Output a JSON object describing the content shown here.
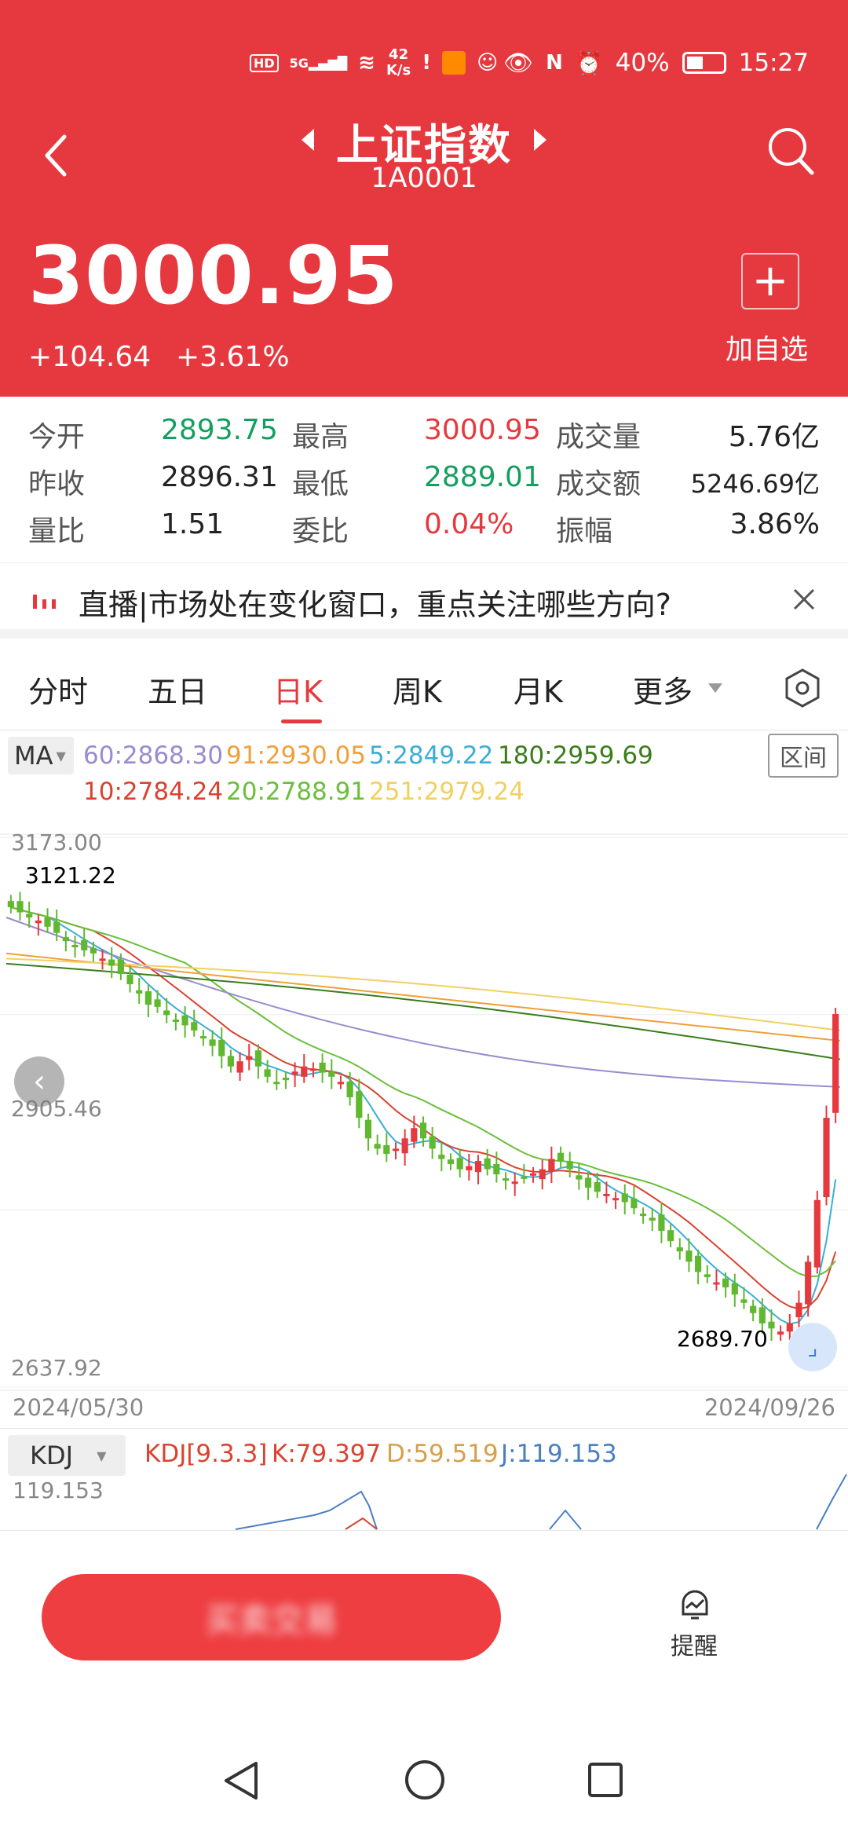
{
  "status_bar": {
    "left_icons": [
      "HD",
      "5G",
      "6",
      "42\nK/s"
    ],
    "netspeed_top": "42",
    "netspeed_bottom": "K/s",
    "battery": "40%",
    "time": "15:27"
  },
  "header": {
    "title": "上证指数",
    "code": "1A0001",
    "price": "3000.95",
    "change": "+104.64",
    "change_pct": "+3.61%",
    "add_label": "加自选",
    "color": "#e6393f"
  },
  "quotes": [
    {
      "label": "今开",
      "value": "2893.75",
      "color": "green"
    },
    {
      "label": "最高",
      "value": "3000.95",
      "color": "red"
    },
    {
      "label": "成交量",
      "value": "5.76亿",
      "color": "black"
    },
    {
      "label": "昨收",
      "value": "2896.31",
      "color": "black"
    },
    {
      "label": "最低",
      "value": "2889.01",
      "color": "green"
    },
    {
      "label": "成交额",
      "value": "5246.69亿",
      "color": "black"
    },
    {
      "label": "量比",
      "value": "1.51",
      "color": "black"
    },
    {
      "label": "委比",
      "value": "0.04%",
      "color": "red"
    },
    {
      "label": "振幅",
      "value": "3.86%",
      "color": "black"
    }
  ],
  "banner": {
    "text": "直播|市场处在变化窗口，重点关注哪些方向?"
  },
  "tabs": [
    "分时",
    "五日",
    "日K",
    "周K",
    "月K",
    "更多"
  ],
  "active_tab": "日K",
  "ma": {
    "selector": "MA",
    "range_button": "区间",
    "values": [
      {
        "label": "60:2868.30",
        "color": "#9a8bd0"
      },
      {
        "label": "91:2930.05",
        "color": "#f0a03a"
      },
      {
        "label": "5:2849.22",
        "color": "#3aaed8"
      },
      {
        "label": "180:2959.69",
        "color": "#3a7d1a"
      },
      {
        "label": "10:2784.24",
        "color": "#d9432f"
      },
      {
        "label": "20:2788.91",
        "color": "#6abf3a"
      },
      {
        "label": "251:2979.24",
        "color": "#f2d060"
      }
    ]
  },
  "chart_data": {
    "type": "candlestick",
    "y_labels": [
      "3173.00",
      "2905.46",
      "2637.92"
    ],
    "ylim": [
      2637.92,
      3173.0
    ],
    "high_label": "3121.22",
    "low_label": "2689.70",
    "x_start": "2024/05/30",
    "x_end": "2024/09/26",
    "closes": [
      3105,
      3100,
      3095,
      3092,
      3086,
      3080,
      3072,
      3068,
      3063,
      3060,
      3055,
      3048,
      3040,
      3030,
      3021,
      3010,
      3008,
      3000,
      2995,
      2990,
      2985,
      2978,
      2970,
      2960,
      2950,
      2955,
      2960,
      2950,
      2940,
      2935,
      2938,
      2945,
      2950,
      2948,
      2944,
      2940,
      2935,
      2920,
      2900,
      2880,
      2870,
      2865,
      2870,
      2880,
      2890,
      2880,
      2870,
      2860,
      2855,
      2850,
      2853,
      2858,
      2850,
      2845,
      2840,
      2838,
      2842,
      2846,
      2850,
      2860,
      2858,
      2850,
      2840,
      2832,
      2828,
      2826,
      2822,
      2818,
      2812,
      2805,
      2800,
      2790,
      2780,
      2770,
      2760,
      2750,
      2745,
      2740,
      2735,
      2728,
      2720,
      2710,
      2700,
      2695,
      2692,
      2700,
      2720,
      2760,
      2820,
      2900,
      3001
    ]
  },
  "kdj": {
    "selector": "KDJ",
    "params": "KDJ[9.3.3]",
    "k": "K:79.397",
    "d": "D:59.519",
    "j": "J:119.153",
    "axis_top": "119.153"
  },
  "bottom": {
    "trade_label": "买卖交易",
    "alert_label": "提醒"
  }
}
